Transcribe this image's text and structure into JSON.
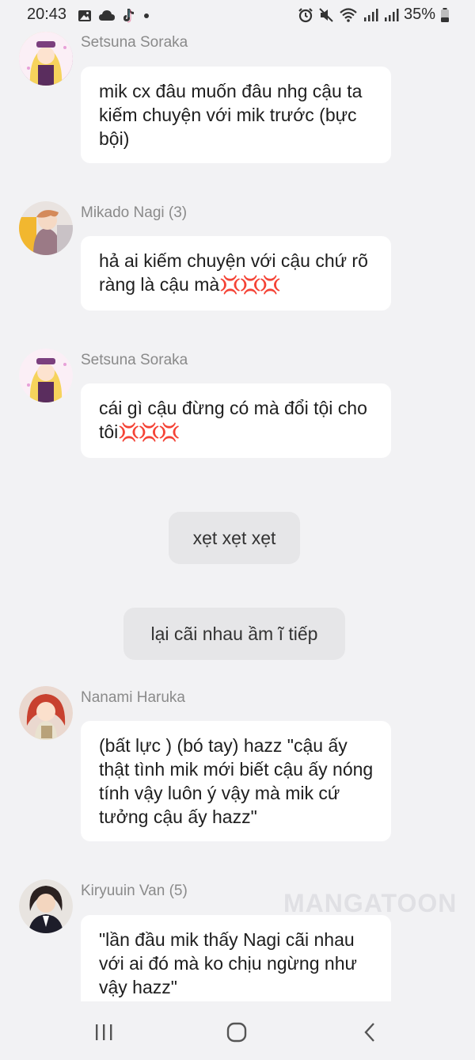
{
  "status_bar": {
    "time": "20:43",
    "battery": "35%",
    "icons_left": [
      "image-icon",
      "cloud-icon",
      "tiktok-icon",
      "dot-icon"
    ],
    "icons_right": [
      "alarm-icon",
      "mute-icon",
      "wifi-icon",
      "signal-icon",
      "signal-icon",
      "battery-icon"
    ]
  },
  "messages": [
    {
      "sender": "Setsuna Soraka",
      "text": "mik cx đâu muốn đâu nhg cậu ta kiếm chuyện với mik trước (bực bội)",
      "emoji": ""
    },
    {
      "sender": "Mikado Nagi (3)",
      "text": "hả ai kiếm chuyện với cậu chứ rõ ràng là cậu mà",
      "emoji": "💢💢💢"
    },
    {
      "sender": "Setsuna Soraka",
      "text": "cái gì cậu đừng có mà đổi tội cho tôi",
      "emoji": "💢💢💢"
    },
    {
      "sender": "Nanami Haruka",
      "text": "(bất lực ) (bó tay) hazz \"cậu ấy thật tình mik mới biết cậu ấy nóng tính vậy luôn ý vậy mà mik cứ tưởng cậu ấy hazz\"",
      "emoji": ""
    },
    {
      "sender": "Kiryuuin Van (5)",
      "text": "\"lần đầu mik thấy Nagi cãi nhau với ai đó mà ko chịu ngừng như vậy hazz\"",
      "emoji": ""
    }
  ],
  "narration": [
    "xẹt xẹt xẹt",
    "lại cãi nhau ầm ĩ tiếp"
  ],
  "watermark": "MANGATOON",
  "colors": {
    "background": "#f2f2f4",
    "bubble": "#ffffff",
    "narration_bubble": "#e6e6e8",
    "sender_name": "#8a8a8a",
    "anger_emoji": "#e0392f"
  },
  "nav_bar": {
    "buttons": [
      "recent-apps-icon",
      "home-icon",
      "back-icon"
    ]
  }
}
